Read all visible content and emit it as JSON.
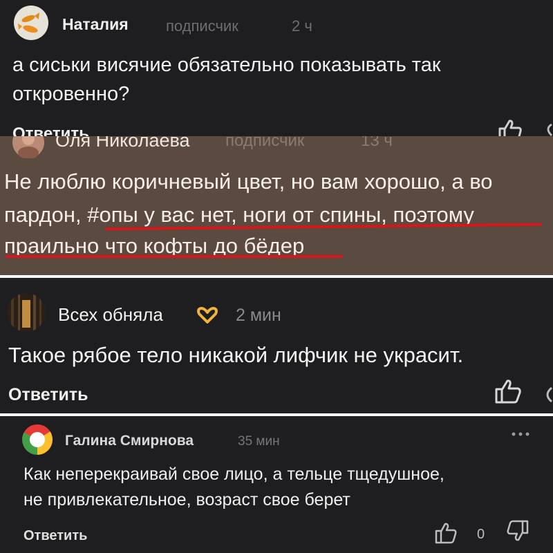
{
  "comments": [
    {
      "author": "Наталия",
      "role": "подписчик",
      "time": "2 ч",
      "lines": [
        "а сиськи висячие обязательно показывать так",
        "откровенно?"
      ],
      "reply_label": "Ответить",
      "avatar_icon": "goldfish-avatar-icon"
    },
    {
      "author": "Оля Николаева",
      "role": "подписчик",
      "time": "13 ч",
      "lines": [
        "Не люблю коричневый цвет, но вам хорошо, а во",
        "пардон, #опы у вас нет, ноги от спины, поэтому",
        "праильно что кофты до бёдер"
      ],
      "avatar_icon": "photo-avatar-icon"
    },
    {
      "author": "Всех обняла",
      "emoji_icon": "heart-hands-emoji-icon",
      "time": "2 мин",
      "lines": [
        "Такое рябое тело никакой лифчик не украсит."
      ],
      "reply_label": "Ответить",
      "avatar_icon": "forest-avatar-icon"
    },
    {
      "author": "Галина Смирнова",
      "time": "35 мин",
      "lines": [
        "Как неперекраивай свое лицо, а тельце тщедушное,",
        "не привлекательное, возраст свое берет"
      ],
      "reply_label": "Ответить",
      "like_count": "0",
      "avatar_icon": "multicolor-avatar-icon"
    }
  ],
  "colors": {
    "dark_bg": "#1e1e20",
    "brown_bg": "#5a4a40",
    "name_text": "#f0f0f0",
    "meta_text": "#7c7c80",
    "underline": "#d8161c"
  }
}
